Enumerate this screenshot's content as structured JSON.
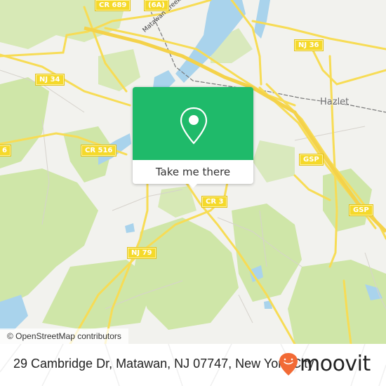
{
  "map": {
    "place_labels": [
      {
        "id": "hazlet",
        "text": "Hazlet"
      }
    ],
    "water_labels": [
      {
        "id": "matawan-creek",
        "text": "Matawan Creek"
      }
    ],
    "road_shields": [
      {
        "id": "cr-689",
        "text": "CR 689"
      },
      {
        "id": "route-6a",
        "text": "(6A)"
      },
      {
        "id": "nj-36",
        "text": "NJ 36"
      },
      {
        "id": "nj-34",
        "text": "NJ 34"
      },
      {
        "id": "cr-516",
        "text": "CR 516"
      },
      {
        "id": "cr-516-edge",
        "text": "6"
      },
      {
        "id": "gsp-1",
        "text": "GSP"
      },
      {
        "id": "gsp-2",
        "text": "GSP"
      },
      {
        "id": "cr-3",
        "text": "CR 3"
      },
      {
        "id": "nj-79",
        "text": "NJ 79"
      }
    ],
    "colors": {
      "land": "#f2f2ee",
      "forest": "#cfe6a8",
      "water": "#a9d3ec",
      "road": "#f7dc55",
      "shield": "#f5d92a"
    }
  },
  "popup": {
    "icon": "map-pin-icon",
    "button_label": "Take me there",
    "accent_color": "#1fba6a"
  },
  "attribution": "© OpenStreetMap contributors",
  "footer": {
    "address": "29 Cambridge Dr, Matawan, NJ 07747, New York City",
    "brand": "moovit",
    "brand_color": "#f26a35"
  }
}
